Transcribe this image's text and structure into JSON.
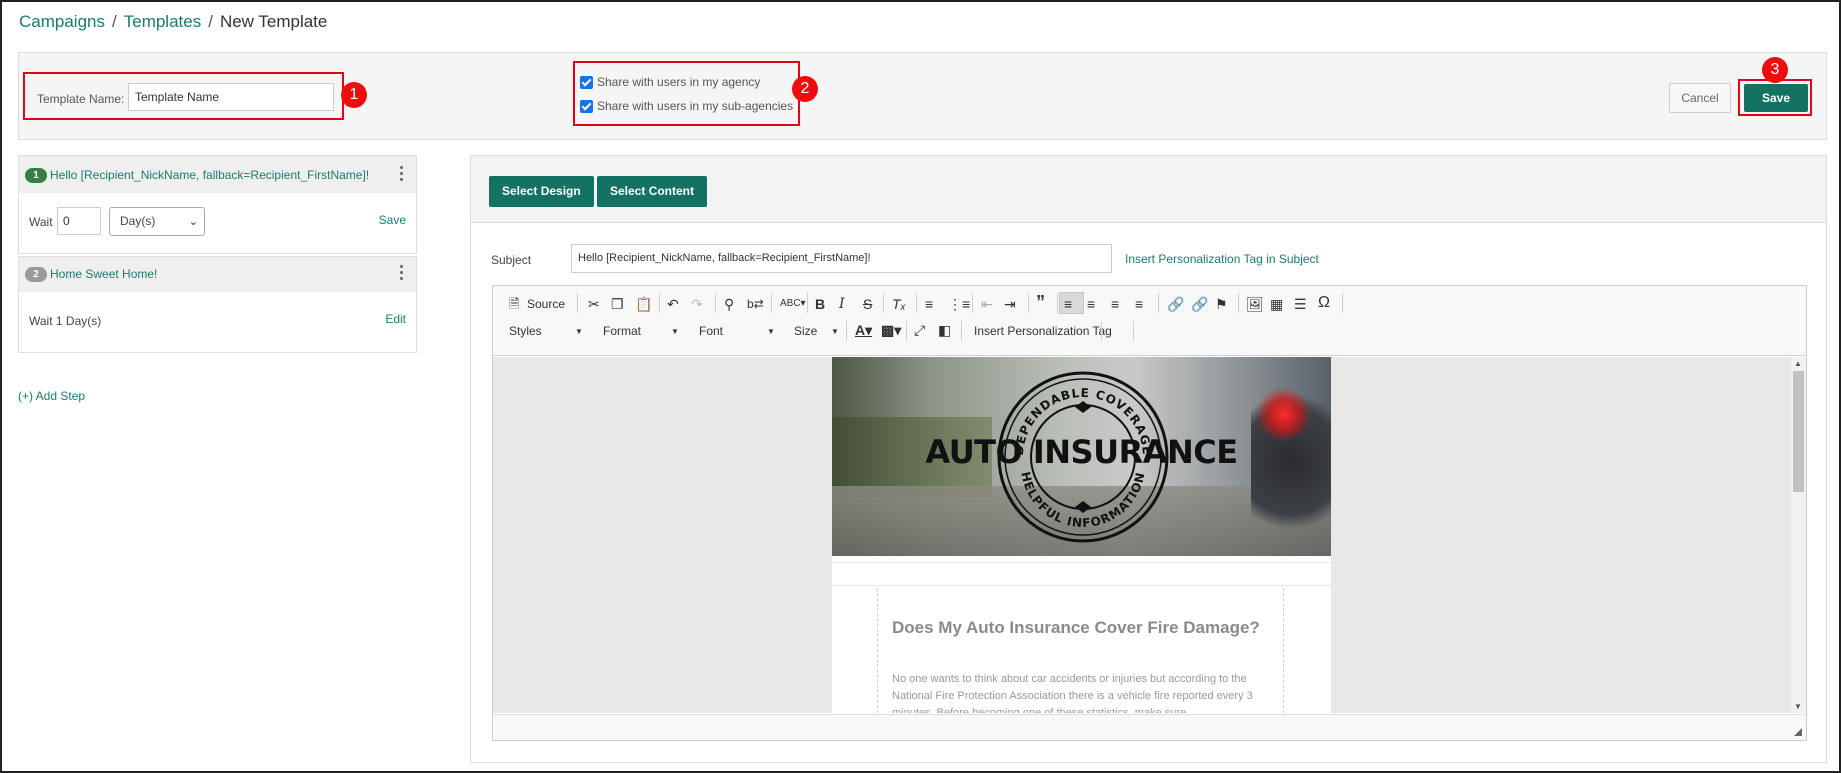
{
  "breadcrumb": {
    "campaigns": "Campaigns",
    "templates": "Templates",
    "current": "New Template",
    "separator": "/"
  },
  "header": {
    "template_name_label": "Template Name:",
    "template_name_value": "Template Name",
    "share_agency": "Share with users in my agency",
    "share_agency_checked": true,
    "share_subagencies": "Share with users in my sub-agencies",
    "share_subagencies_checked": true,
    "cancel": "Cancel",
    "save": "Save",
    "callouts": [
      "1",
      "2",
      "3"
    ]
  },
  "steps": [
    {
      "number": "1",
      "title": "Hello [Recipient_NickName, fallback=Recipient_FirstName]!",
      "wait_label": "Wait",
      "wait_value": "0",
      "wait_unit": "Day(s)",
      "action": "Save",
      "badge_color": "#3a7d44"
    },
    {
      "number": "2",
      "title": "Home Sweet Home!",
      "wait_text": "Wait 1 Day(s)",
      "action": "Edit",
      "badge_color": "#9a9a9a"
    }
  ],
  "add_step": "(+) Add Step",
  "editor": {
    "select_design": "Select Design",
    "select_content": "Select Content",
    "subject_label": "Subject",
    "subject_value": "Hello [Recipient_NickName, fallback=Recipient_FirstName]!",
    "subject_tag_link": "Insert Personalization Tag in Subject",
    "toolbar": {
      "source": "Source",
      "styles": "Styles",
      "format": "Format",
      "font": "Font",
      "size": "Size",
      "insert_tag": "Insert Personalization Tag"
    },
    "email": {
      "hero_title": "AUTO INSURANCE",
      "seal_top": "DEPENDABLE COVERAGE",
      "seal_bottom": "HELPFUL INFORMATION",
      "article_title": "Does My Auto Insurance Cover Fire Damage?",
      "article_text": "No one wants to think about car accidents or injuries but according to the National Fire Protection Association there is a vehicle fire reported every 3 minutes. Before becoming one of these statistics, make sure"
    }
  },
  "colors": {
    "accent": "#137262",
    "link": "#1c7a6d",
    "callout": "#ee0d0d"
  }
}
